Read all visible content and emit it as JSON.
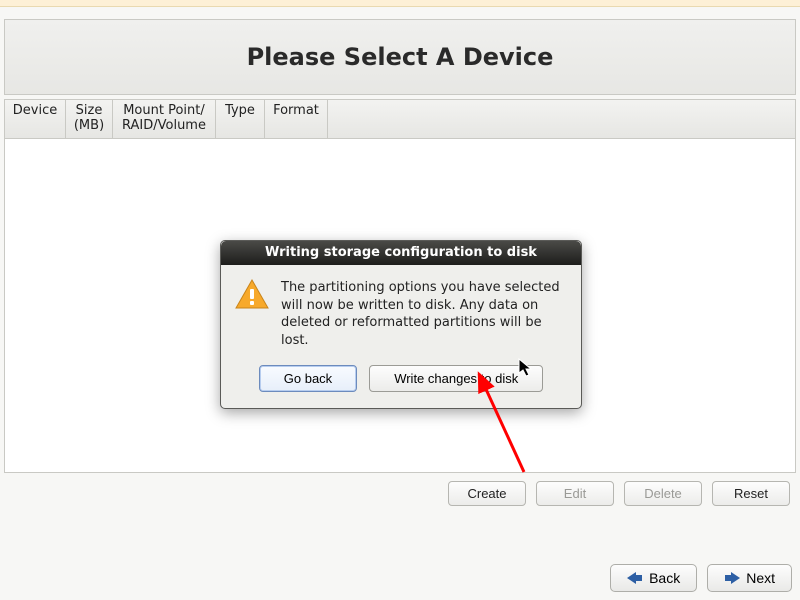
{
  "heading": "Please Select A Device",
  "columns": {
    "device": "Device",
    "size": "Size\n(MB)",
    "mount": "Mount Point/\nRAID/Volume",
    "type": "Type",
    "format": "Format"
  },
  "actions": {
    "create": "Create",
    "edit": "Edit",
    "delete": "Delete",
    "reset": "Reset"
  },
  "nav": {
    "back": "Back",
    "next": "Next"
  },
  "dialog": {
    "title": "Writing storage configuration to disk",
    "message": "The partitioning options you have selected will now be written to disk.  Any data on deleted or reformatted partitions will be lost.",
    "go_back": "Go back",
    "write": "Write changes to disk"
  }
}
